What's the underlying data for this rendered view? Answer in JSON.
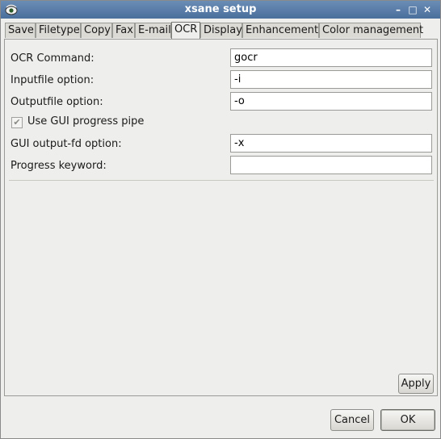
{
  "window": {
    "title": "xsane setup"
  },
  "tabs": [
    {
      "label": "Save"
    },
    {
      "label": "Filetype"
    },
    {
      "label": "Copy"
    },
    {
      "label": "Fax"
    },
    {
      "label": "E-mail"
    },
    {
      "label": "OCR",
      "active": true
    },
    {
      "label": "Display"
    },
    {
      "label": "Enhancement"
    },
    {
      "label": "Color management"
    }
  ],
  "ocr": {
    "command": {
      "label": "OCR Command:",
      "value": "gocr"
    },
    "inputfile": {
      "label": "Inputfile option:",
      "value": "-i"
    },
    "outputfile": {
      "label": "Outputfile option:",
      "value": "-o"
    },
    "gui_progress": {
      "label": "Use GUI progress pipe",
      "checked": true
    },
    "gui_fd": {
      "label": "GUI output-fd option:",
      "value": "-x"
    },
    "progress_keyword": {
      "label": "Progress keyword:",
      "value": ""
    }
  },
  "buttons": {
    "apply": "Apply",
    "cancel": "Cancel",
    "ok": "OK"
  },
  "colors": {
    "titlebar": "#5a7fab",
    "background": "#eeeeec"
  }
}
